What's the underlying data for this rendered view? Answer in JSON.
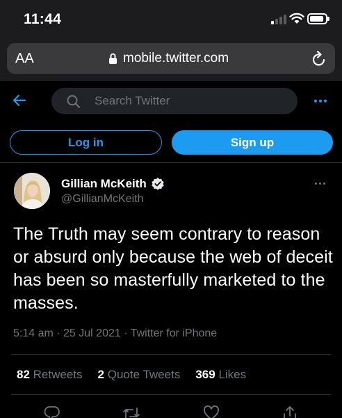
{
  "status_bar": {
    "time": "11:44"
  },
  "browser": {
    "aa_label": "AA",
    "url": "mobile.twitter.com"
  },
  "header": {
    "search_placeholder": "Search Twitter"
  },
  "auth": {
    "login_label": "Log in",
    "signup_label": "Sign up"
  },
  "tweet": {
    "display_name": "Gillian McKeith",
    "handle": "@GillianMcKeith",
    "text": "The Truth  may seem contrary to reason or absurd only because the web of deceit has been so masterfully marketed to the masses.",
    "meta": "5:14 am · 25 Jul 2021 · Twitter for iPhone",
    "stats": [
      {
        "count": "82",
        "label": "Retweets"
      },
      {
        "count": "2",
        "label": "Quote Tweets"
      },
      {
        "count": "369",
        "label": "Likes"
      }
    ]
  },
  "colors": {
    "accent": "#1d9bf0",
    "background": "#000000",
    "secondary_text": "#71767b",
    "divider": "#2f3336"
  },
  "icons": [
    "back-arrow-icon",
    "search-icon",
    "more-icon",
    "verified-badge-icon",
    "lock-icon",
    "reload-icon",
    "reply-icon",
    "retweet-icon",
    "like-icon",
    "share-icon"
  ]
}
